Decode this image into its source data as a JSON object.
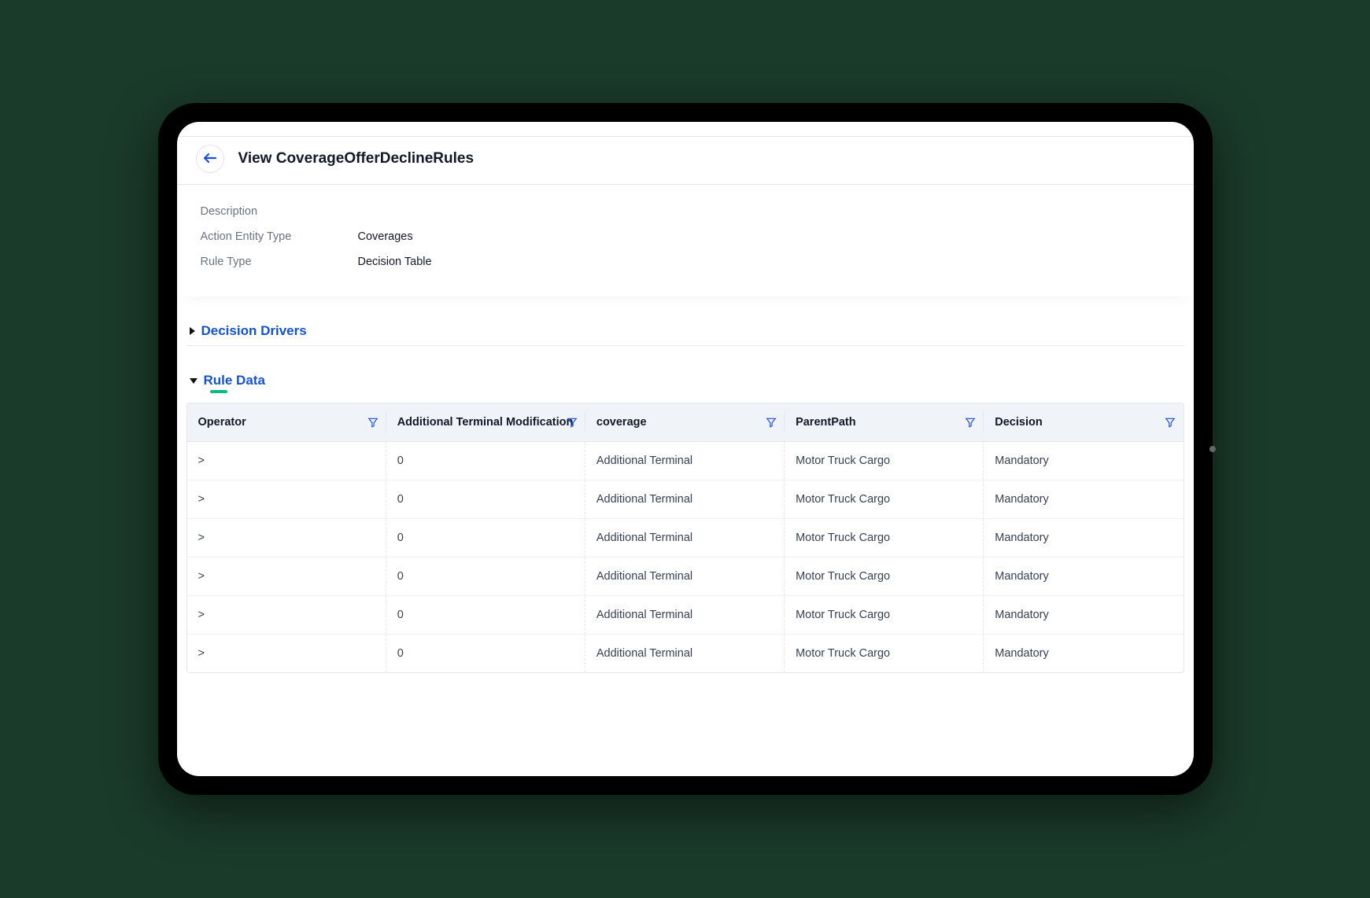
{
  "header": {
    "title": "View CoverageOfferDeclineRules"
  },
  "info": {
    "labels": {
      "description": "Description",
      "actionEntityType": "Action Entity Type",
      "ruleType": "Rule Type"
    },
    "values": {
      "description": "",
      "actionEntityType": "Coverages",
      "ruleType": "Decision Table"
    }
  },
  "sections": {
    "decisionDrivers": "Decision Drivers",
    "ruleData": "Rule Data"
  },
  "table": {
    "columns": [
      "Operator",
      "Additional Terminal Modification",
      "coverage",
      "ParentPath",
      "Decision"
    ],
    "rows": [
      {
        "operator": ">",
        "modification": "0",
        "coverage": "Additional Terminal",
        "parentPath": "Motor Truck Cargo",
        "decision": "Mandatory"
      },
      {
        "operator": ">",
        "modification": "0",
        "coverage": "Additional Terminal",
        "parentPath": "Motor Truck Cargo",
        "decision": "Mandatory"
      },
      {
        "operator": ">",
        "modification": "0",
        "coverage": "Additional Terminal",
        "parentPath": "Motor Truck Cargo",
        "decision": "Mandatory"
      },
      {
        "operator": ">",
        "modification": "0",
        "coverage": "Additional Terminal",
        "parentPath": "Motor Truck Cargo",
        "decision": "Mandatory"
      },
      {
        "operator": ">",
        "modification": "0",
        "coverage": "Additional Terminal",
        "parentPath": "Motor Truck Cargo",
        "decision": "Mandatory"
      },
      {
        "operator": ">",
        "modification": "0",
        "coverage": "Additional Terminal",
        "parentPath": "Motor Truck Cargo",
        "decision": "Mandatory"
      }
    ]
  }
}
